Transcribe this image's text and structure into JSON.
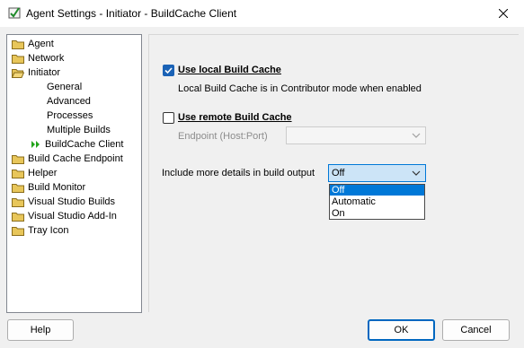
{
  "window": {
    "title": "Agent Settings - Initiator - BuildCache Client"
  },
  "tree": {
    "items": [
      {
        "label": "Agent",
        "type": "folder"
      },
      {
        "label": "Network",
        "type": "folder"
      },
      {
        "label": "Initiator",
        "type": "folder-open"
      },
      {
        "label": "General",
        "type": "child"
      },
      {
        "label": "Advanced",
        "type": "child"
      },
      {
        "label": "Processes",
        "type": "child"
      },
      {
        "label": "Multiple Builds",
        "type": "child"
      },
      {
        "label": "BuildCache Client",
        "type": "child-selected"
      },
      {
        "label": "Build Cache Endpoint",
        "type": "folder"
      },
      {
        "label": "Helper",
        "type": "folder"
      },
      {
        "label": "Build Monitor",
        "type": "folder"
      },
      {
        "label": "Visual Studio Builds",
        "type": "folder"
      },
      {
        "label": "Visual Studio Add-In",
        "type": "folder"
      },
      {
        "label": "Tray Icon",
        "type": "folder"
      }
    ]
  },
  "panel": {
    "local_cache_label": "Use local Build Cache",
    "local_cache_checked": true,
    "local_cache_desc": "Local Build Cache is in Contributor mode when enabled",
    "remote_cache_label": "Use remote Build Cache",
    "remote_cache_checked": false,
    "endpoint_label": "Endpoint (Host:Port)",
    "endpoint_value": "",
    "details_label": "Include more details in build output",
    "details_value": "Off",
    "details_options": [
      "Off",
      "Automatic",
      "On"
    ]
  },
  "buttons": {
    "help": "Help",
    "ok": "OK",
    "cancel": "Cancel"
  },
  "colors": {
    "accent": "#0078d7",
    "checkbox": "#1a62b6",
    "folder": "#e8c65a"
  }
}
